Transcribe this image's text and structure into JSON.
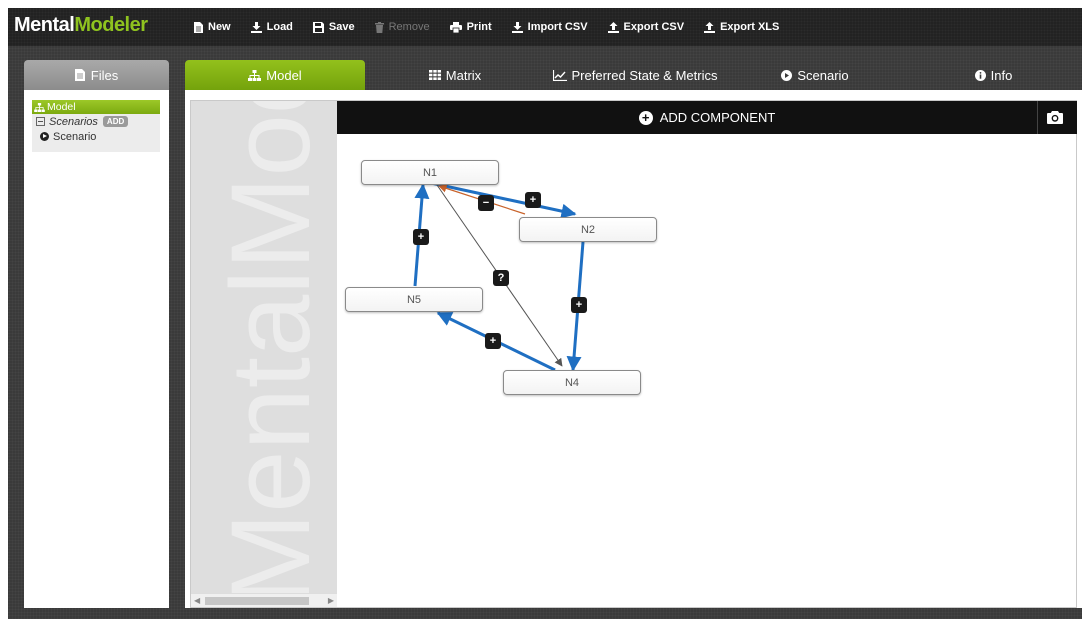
{
  "app": {
    "logo_part1": "Mental",
    "logo_part2": "Modeler",
    "colors": {
      "accent": "#8fc31f",
      "edge_positive": "#1f6fc2",
      "edge_negative": "#c8622a",
      "edge_unknown": "#555555"
    }
  },
  "toolbar": [
    {
      "label": "New",
      "icon": "file-icon",
      "disabled": false
    },
    {
      "label": "Load",
      "icon": "download-icon",
      "disabled": false
    },
    {
      "label": "Save",
      "icon": "save-icon",
      "disabled": false
    },
    {
      "label": "Remove",
      "icon": "trash-icon",
      "disabled": true
    },
    {
      "label": "Print",
      "icon": "print-icon",
      "disabled": false
    },
    {
      "label": "Import CSV",
      "icon": "download-icon",
      "disabled": false
    },
    {
      "label": "Export CSV",
      "icon": "upload-icon",
      "disabled": false
    },
    {
      "label": "Export XLS",
      "icon": "upload-icon",
      "disabled": false
    }
  ],
  "files_tab": {
    "label": "Files",
    "icon": "file-icon"
  },
  "tabs": [
    {
      "label": "Model",
      "icon": "sitemap-icon",
      "active": true
    },
    {
      "label": "Matrix",
      "icon": "grid-icon",
      "active": false
    },
    {
      "label": "Preferred State & Metrics",
      "icon": "line-chart-icon",
      "active": false
    },
    {
      "label": "Scenario",
      "icon": "play-circle-icon",
      "active": false
    },
    {
      "label": "Info",
      "icon": "info-circle-icon",
      "active": false
    }
  ],
  "tree": {
    "model_label": "Model",
    "scenarios_label": "Scenarios",
    "add_label": "ADD",
    "scenario_item": "Scenario"
  },
  "canvas": {
    "watermark": "MentalModeler",
    "add_component_label": "ADD COMPONENT"
  },
  "nodes": [
    {
      "id": "n1",
      "label": "N1"
    },
    {
      "id": "n2",
      "label": "N2"
    },
    {
      "id": "n5",
      "label": "N5"
    },
    {
      "id": "n4",
      "label": "N4"
    }
  ],
  "edges": [
    {
      "from": "N1",
      "to": "N2",
      "sign": "+"
    },
    {
      "from": "N2",
      "to": "N1",
      "sign": "−"
    },
    {
      "from": "N1",
      "to": "N4",
      "sign": "?"
    },
    {
      "from": "N2",
      "to": "N4",
      "sign": "+"
    },
    {
      "from": "N4",
      "to": "N5",
      "sign": "+"
    },
    {
      "from": "N5",
      "to": "N1",
      "sign": "+"
    }
  ]
}
